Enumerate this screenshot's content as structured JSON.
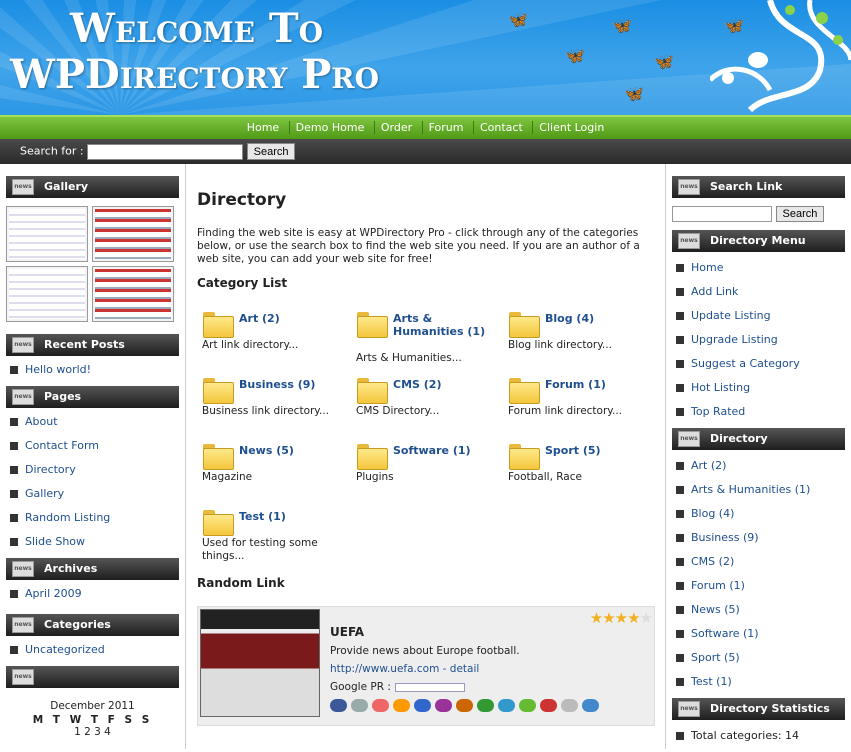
{
  "header": {
    "title_line1": "Welcome To",
    "title_line2": "WPDirectory Pro"
  },
  "nav": [
    "Home",
    "Demo Home",
    "Order",
    "Forum",
    "Contact",
    "Client Login"
  ],
  "search": {
    "label": "Search for :",
    "button": "Search",
    "value": ""
  },
  "left": {
    "gallery_title": "Gallery",
    "recent_title": "Recent Posts",
    "recent": [
      "Hello world!"
    ],
    "pages_title": "Pages",
    "pages": [
      "About",
      "Contact Form",
      "Directory",
      "Gallery",
      "Random Listing",
      "Slide Show"
    ],
    "archives_title": "Archives",
    "archives": [
      "April 2009"
    ],
    "categories_title": "Categories",
    "categories": [
      "Uncategorized"
    ],
    "calendar_month": "December 2011",
    "calendar_days": "M T W T F S S",
    "calendar_row": "1 2 3 4"
  },
  "main": {
    "title": "Directory",
    "intro": "Finding the web site is easy at WPDirectory Pro - click through any of the categories below, or use the search box to find the web site you need. If you are an author of a web site, you can add your web site for free!",
    "category_heading": "Category List",
    "categories": [
      {
        "name": "Art (2)",
        "desc": "Art link directory..."
      },
      {
        "name": "Arts & Humanities (1)",
        "desc": "Arts & Humanities..."
      },
      {
        "name": "Blog (4)",
        "desc": "Blog link directory..."
      },
      {
        "name": "Business (9)",
        "desc": "Business link directory..."
      },
      {
        "name": "CMS (2)",
        "desc": "CMS Directory..."
      },
      {
        "name": "Forum (1)",
        "desc": "Forum link directory..."
      },
      {
        "name": "News (5)",
        "desc": "Magazine"
      },
      {
        "name": "Software (1)",
        "desc": "Plugins"
      },
      {
        "name": "Sport (5)",
        "desc": "Football, Race"
      },
      {
        "name": "Test (1)",
        "desc": "Used for testing some things..."
      }
    ],
    "random_heading": "Random Link",
    "random": {
      "name": "UEFA",
      "desc": "Provide news about Europe football.",
      "url": "http://www.uefa.com - detail",
      "pr_label": "Google PR :",
      "rating": 3.5
    }
  },
  "right": {
    "search_title": "Search Link",
    "search_button": "Search",
    "menu_title": "Directory Menu",
    "menu": [
      "Home",
      "Add Link",
      "Update Listing",
      "Upgrade Listing",
      "Suggest a Category",
      "Hot Listing",
      "Top Rated"
    ],
    "dir_title": "Directory",
    "dir": [
      "Art (2)",
      "Arts & Humanities (1)",
      "Blog (4)",
      "Business (9)",
      "CMS (2)",
      "Forum (1)",
      "News (5)",
      "Software (1)",
      "Sport (5)",
      "Test (1)"
    ],
    "stats_title": "Directory Statistics",
    "stats": [
      "Total categories: 14"
    ]
  },
  "colors": {
    "header_blue": "#2b97e6",
    "nav_green": "#5aa81e",
    "link": "#1f4f8f"
  }
}
